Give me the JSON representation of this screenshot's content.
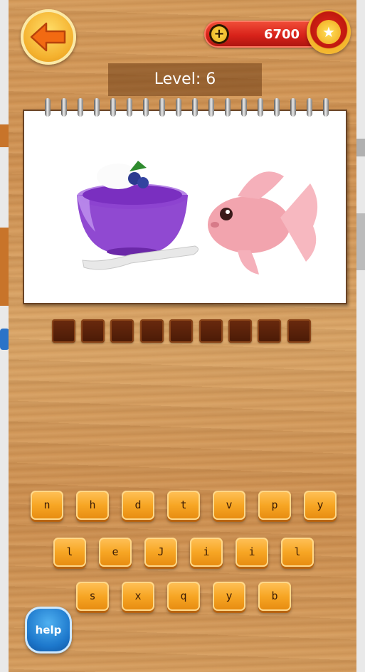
{
  "header": {
    "coins": "6700",
    "add_coins_symbol": "+",
    "coin_icon": "star-coin-icon",
    "back_icon": "back-arrow-icon"
  },
  "level_label": "Level: 6",
  "puzzle": {
    "images": [
      "jelly-dessert-image",
      "pink-fish-image"
    ],
    "answer_slots": 9
  },
  "keyboard": {
    "rows": [
      [
        "n",
        "h",
        "d",
        "t",
        "v",
        "p",
        "y"
      ],
      [
        "l",
        "e",
        "J",
        "i",
        "i",
        "l"
      ],
      [
        "s",
        "x",
        "q",
        "y",
        "b"
      ]
    ]
  },
  "help_label": "help",
  "colors": {
    "accent_orange": "#f7a624",
    "coin_bar_red": "#d8221a",
    "help_blue": "#1d78cc",
    "slot_brown": "#4a1a06"
  }
}
